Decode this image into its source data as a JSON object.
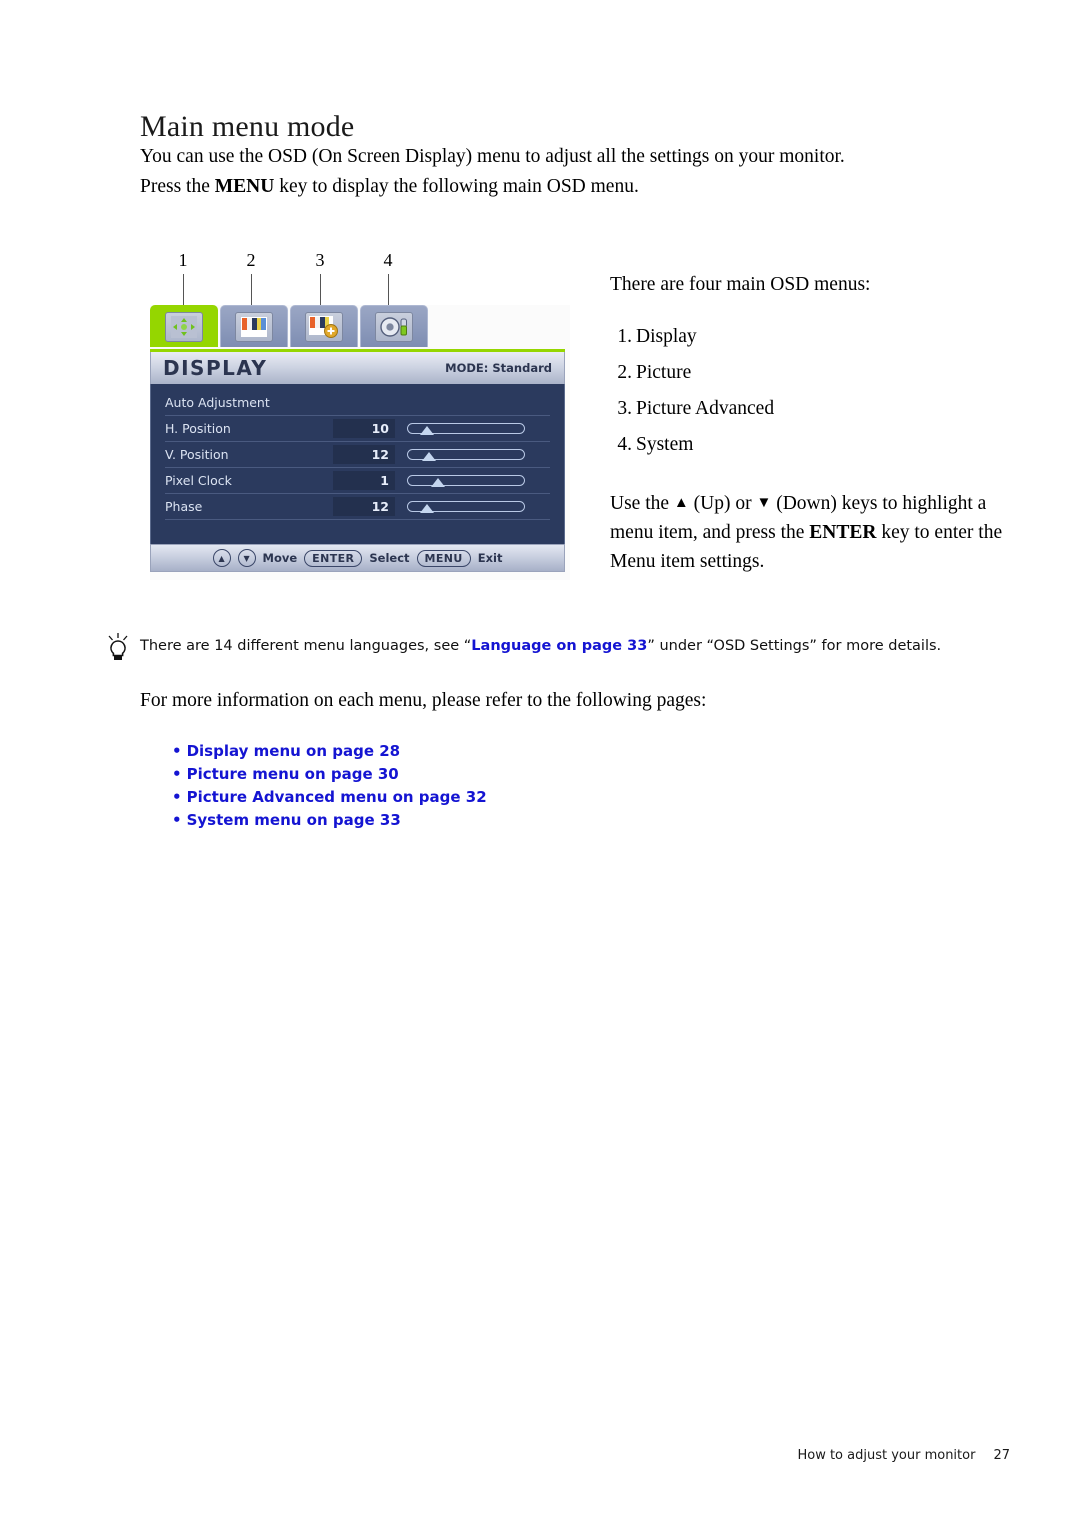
{
  "heading": "Main menu mode",
  "intro": {
    "line1_a": "You can use the OSD (On Screen Display) menu to adjust all the settings on your monitor.",
    "line2_a": "Press the ",
    "line2_kw": "MENU",
    "line2_b": " key to display the following main OSD menu."
  },
  "callouts": [
    {
      "num": "1"
    },
    {
      "num": "2"
    },
    {
      "num": "3"
    },
    {
      "num": "4"
    }
  ],
  "osd": {
    "tabs": [
      {
        "name": "display-tab",
        "icon": "move-arrows-icon",
        "active": true
      },
      {
        "name": "picture-tab",
        "icon": "color-bars-icon",
        "active": false
      },
      {
        "name": "picture-advanced-tab",
        "icon": "color-bars-plus-icon",
        "active": false
      },
      {
        "name": "system-tab",
        "icon": "gear-tool-icon",
        "active": false
      }
    ],
    "title": "DISPLAY",
    "mode": "MODE: Standard",
    "rows": [
      {
        "label": "Auto Adjustment",
        "value": "",
        "slider": null
      },
      {
        "label": "H. Position",
        "value": "10",
        "slider": 16
      },
      {
        "label": "V. Position",
        "value": "12",
        "slider": 18
      },
      {
        "label": "Pixel Clock",
        "value": "1",
        "slider": 26
      },
      {
        "label": "Phase",
        "value": "12",
        "slider": 16
      }
    ],
    "footer": {
      "up_glyph": "▲",
      "down_glyph": "▼",
      "move_label": "Move",
      "enter_key": "ENTER",
      "select_label": "Select",
      "menu_key": "MENU",
      "exit_label": "Exit"
    },
    "accent_green": "#95d600",
    "body_blue": "#2b3a5e"
  },
  "right": {
    "lead": "There are four main OSD menus:",
    "menus": [
      {
        "num": "1.",
        "label": "Display"
      },
      {
        "num": "2.",
        "label": "Picture"
      },
      {
        "num": "3.",
        "label": "Picture Advanced"
      },
      {
        "num": "4.",
        "label": "System"
      }
    ],
    "keys": {
      "a": "Use the ",
      "up_glyph": "▲",
      "b": " (Up) or ",
      "down_glyph": "▼",
      "c": " (Down) keys to highlight a menu item, and press the ",
      "enter": "ENTER",
      "d": " key to enter the Menu item settings."
    }
  },
  "tip": {
    "icon": "lightbulb-icon",
    "a": "There are 14 different menu languages, see “",
    "link": "Language on page 33",
    "b": "” under “OSD Settings” for more details.",
    "link_color": "#1414d2"
  },
  "more_info": "For more information on each menu, please refer to the following pages:",
  "links": [
    "Display menu on page 28",
    "Picture menu on page 30",
    "Picture Advanced menu on page 32",
    "System menu on page 33"
  ],
  "footer": {
    "text": "How to adjust your monitor",
    "page": "27"
  }
}
